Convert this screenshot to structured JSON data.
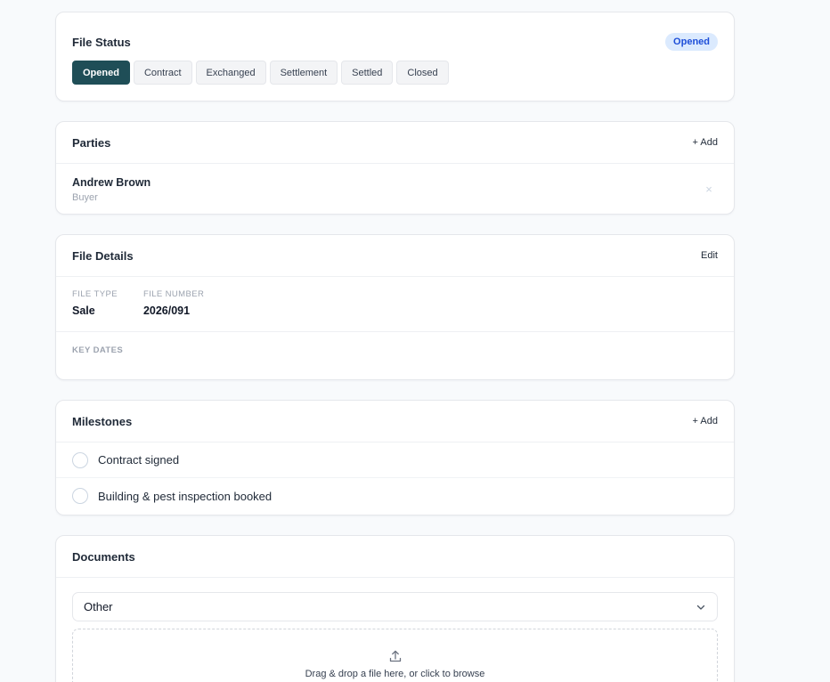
{
  "file_status": {
    "title": "File Status",
    "badge": "Opened",
    "steps": [
      "Opened",
      "Contract",
      "Exchanged",
      "Settlement",
      "Settled",
      "Closed"
    ],
    "active_step": "Opened"
  },
  "parties": {
    "title": "Parties",
    "add_label": "+ Add",
    "items": [
      {
        "name": "Andrew Brown",
        "role": "Buyer"
      }
    ],
    "remove_glyph": "×"
  },
  "file_details": {
    "title": "File Details",
    "edit_label": "Edit",
    "fields": [
      {
        "label": "FILE TYPE",
        "value": "Sale"
      },
      {
        "label": "FILE NUMBER",
        "value": "2026/091"
      }
    ],
    "key_dates_label": "KEY DATES"
  },
  "milestones": {
    "title": "Milestones",
    "add_label": "+ Add",
    "items": [
      {
        "label": "Contract signed",
        "done": false
      },
      {
        "label": "Building & pest inspection booked",
        "done": false
      }
    ]
  },
  "documents": {
    "title": "Documents",
    "select_value": "Other",
    "dropzone_text": "Drag & drop a file here, or click to browse"
  },
  "colors": {
    "accent": "#1f4e57",
    "badge_bg": "#dbeafe",
    "badge_text": "#1d4ed8"
  },
  "icons": {
    "remove": "close-icon",
    "select": "chevron-down-icon",
    "upload": "upload-icon"
  }
}
